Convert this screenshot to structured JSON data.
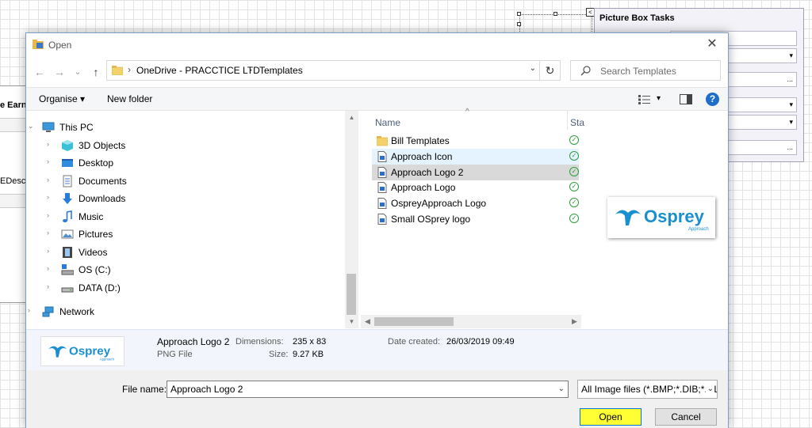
{
  "background": {
    "form_labels": [
      "e Earn",
      "EDescr"
    ],
    "tasks_panel_title": "Picture Box Tasks",
    "tasks_field_glyphs": [
      "▾",
      "...",
      "▾",
      "▾",
      "..."
    ]
  },
  "dialog": {
    "title": "Open",
    "close_glyph": "✕",
    "nav": {
      "back_glyph": "←",
      "forward_glyph": "→",
      "recent_glyph": "⌄",
      "up_glyph": "↑",
      "refresh_glyph": "↻",
      "breadcrumb": [
        "OneDrive - PRACCTICE LTD",
        "Templates"
      ],
      "crumb_sep": "›",
      "search_placeholder": "Search Templates"
    },
    "commands": {
      "organise": "Organise ▾",
      "new_folder": "New folder",
      "view_glyph": "▾",
      "help_glyph": "?"
    },
    "tree": [
      {
        "label": "This PC",
        "icon": "computer-icon",
        "indent": 0,
        "expanded": true
      },
      {
        "label": "3D Objects",
        "icon": "cube-icon",
        "indent": 1
      },
      {
        "label": "Desktop",
        "icon": "desktop-icon",
        "indent": 1
      },
      {
        "label": "Documents",
        "icon": "documents-icon",
        "indent": 1
      },
      {
        "label": "Downloads",
        "icon": "download-icon",
        "indent": 1
      },
      {
        "label": "Music",
        "icon": "music-icon",
        "indent": 1
      },
      {
        "label": "Pictures",
        "icon": "pictures-icon",
        "indent": 1
      },
      {
        "label": "Videos",
        "icon": "video-icon",
        "indent": 1
      },
      {
        "label": "OS (C:)",
        "icon": "drive-os-icon",
        "indent": 1
      },
      {
        "label": "DATA (D:)",
        "icon": "drive-icon",
        "indent": 1
      },
      {
        "label": "Network",
        "icon": "network-icon",
        "indent": 0
      }
    ],
    "columns": {
      "name": "Name",
      "status": "Sta"
    },
    "files": [
      {
        "name": "Bill Templates",
        "type": "folder",
        "state": "normal"
      },
      {
        "name": "Approach Icon",
        "type": "image",
        "state": "hover"
      },
      {
        "name": "Approach Logo 2",
        "type": "image",
        "state": "selected"
      },
      {
        "name": "Approach Logo",
        "type": "image",
        "state": "normal"
      },
      {
        "name": "OspreyApproach Logo",
        "type": "image",
        "state": "normal"
      },
      {
        "name": "Small OSprey logo",
        "type": "image",
        "state": "normal"
      }
    ],
    "status_glyph": "✓",
    "logo": {
      "word": "Osprey",
      "tagline": "Approach"
    },
    "details": {
      "name": "Approach Logo 2",
      "type": "PNG File",
      "dimensions_label": "Dimensions:",
      "dimensions_value": "235 x 83",
      "size_label": "Size:",
      "size_value": "9.27 KB",
      "date_label": "Date created:",
      "date_value": "26/03/2019 09:49"
    },
    "bottom": {
      "file_name_label": "File name:",
      "file_name_value": "Approach Logo 2",
      "filter_value": "All Image files (*.BMP;*.DIB;*.RLE",
      "open_label": "Open",
      "cancel_label": "Cancel",
      "dropdown_glyph": "⌄"
    }
  },
  "colors": {
    "highlight": "#ffff33",
    "selected_row": "#d9d9d9",
    "hover_row": "#e5f3ff",
    "accent": "#0078d7",
    "logo_blue": "#1a8fd0"
  }
}
